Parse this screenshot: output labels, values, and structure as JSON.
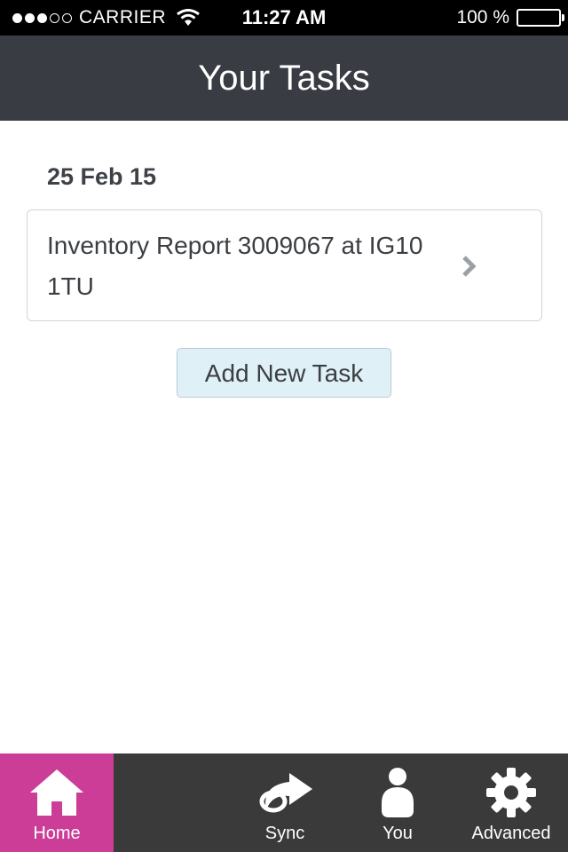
{
  "status_bar": {
    "carrier": "CARRIER",
    "time": "11:27 AM",
    "battery_percent": "100 %",
    "signal_strength": 3,
    "signal_max": 5
  },
  "header": {
    "title": "Your Tasks"
  },
  "tasks": {
    "date": "25 Feb 15",
    "items": [
      {
        "label": "Inventory Report 3009067 at IG10 1TU"
      }
    ],
    "add_button_label": "Add New Task"
  },
  "tab_bar": {
    "active_color": "#cb3d96",
    "tabs": [
      {
        "label": "Home",
        "icon": "home-icon",
        "active": true
      },
      {
        "label": "Sync",
        "icon": "share-arrow-icon",
        "active": false
      },
      {
        "label": "You",
        "icon": "person-icon",
        "active": false
      },
      {
        "label": "Advanced",
        "icon": "gear-icon",
        "active": false
      }
    ]
  }
}
